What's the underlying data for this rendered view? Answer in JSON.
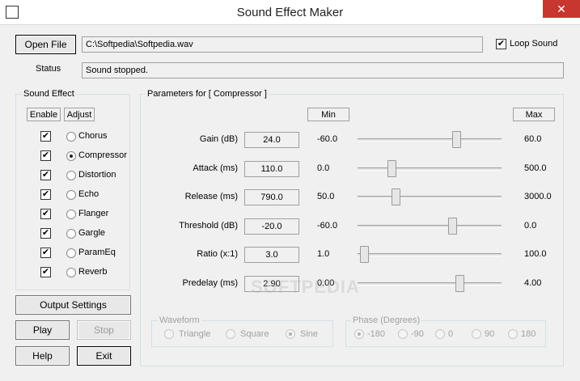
{
  "window": {
    "title": "Sound Effect Maker",
    "close_glyph": "✕"
  },
  "file": {
    "open_label": "Open File",
    "path": "C:\\Softpedia\\Softpedia.wav",
    "loop_label": "Loop Sound",
    "loop_checked": true
  },
  "status": {
    "label": "Status",
    "text": "Sound stopped."
  },
  "effects": {
    "group_label": "Sound Effect",
    "enable_header": "Enable",
    "adjust_header": "Adjust",
    "items": [
      {
        "label": "Chorus",
        "enabled": true,
        "selected": false
      },
      {
        "label": "Compressor",
        "enabled": true,
        "selected": true
      },
      {
        "label": "Distortion",
        "enabled": true,
        "selected": false
      },
      {
        "label": "Echo",
        "enabled": true,
        "selected": false
      },
      {
        "label": "Flanger",
        "enabled": true,
        "selected": false
      },
      {
        "label": "Gargle",
        "enabled": true,
        "selected": false
      },
      {
        "label": "ParamEq",
        "enabled": true,
        "selected": false
      },
      {
        "label": "Reverb",
        "enabled": true,
        "selected": false
      }
    ]
  },
  "buttons": {
    "output_settings": "Output Settings",
    "play": "Play",
    "stop": "Stop",
    "help": "Help",
    "exit": "Exit"
  },
  "params": {
    "group_label": "Parameters for [ Compressor ]",
    "min_header": "Min",
    "max_header": "Max",
    "rows": [
      {
        "label": "Gain (dB)",
        "value": "24.0",
        "min": "-60.0",
        "max": "60.0",
        "level": 0.7
      },
      {
        "label": "Attack (ms)",
        "value": "110.0",
        "min": "0.0",
        "max": "500.0",
        "level": 0.22
      },
      {
        "label": "Release (ms)",
        "value": "790.0",
        "min": "50.0",
        "max": "3000.0",
        "level": 0.25
      },
      {
        "label": "Threshold (dB)",
        "value": "-20.0",
        "min": "-60.0",
        "max": "0.0",
        "level": 0.67
      },
      {
        "label": "Ratio (x:1)",
        "value": "3.0",
        "min": "1.0",
        "max": "100.0",
        "level": 0.02
      },
      {
        "label": "Predelay (ms)",
        "value": "2.90",
        "min": "0.00",
        "max": "4.00",
        "level": 0.725
      }
    ],
    "waveform": {
      "group_label": "Waveform",
      "options": [
        {
          "label": "Triangle",
          "selected": false
        },
        {
          "label": "Square",
          "selected": false
        },
        {
          "label": "Sine",
          "selected": true
        }
      ]
    },
    "phase": {
      "group_label": "Phase (Degrees)",
      "options": [
        {
          "label": "-180",
          "selected": true
        },
        {
          "label": "-90",
          "selected": false
        },
        {
          "label": "0",
          "selected": false
        },
        {
          "label": "90",
          "selected": false
        },
        {
          "label": "180",
          "selected": false
        }
      ]
    }
  },
  "watermark": "SOFTPEDIA"
}
